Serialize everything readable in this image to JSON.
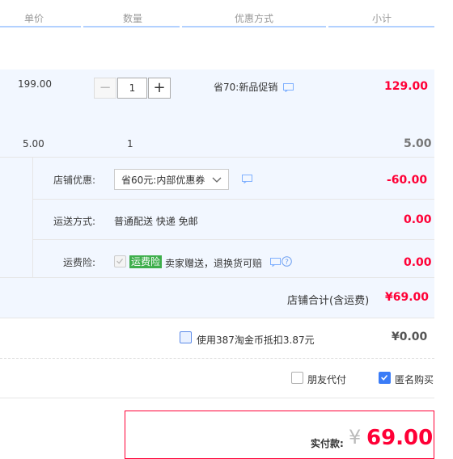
{
  "header": {
    "col_price": "单价",
    "col_qty": "数量",
    "col_discount": "优惠方式",
    "col_subtotal": "小计"
  },
  "item1": {
    "unit_price": "199.00",
    "quantity": "1",
    "minus": "−",
    "plus": "+",
    "promotion": "省70:新品促销",
    "subtotal": "129.00"
  },
  "item2": {
    "unit_price": "5.00",
    "quantity": "1",
    "subtotal": "5.00"
  },
  "shop_discount": {
    "label": "店铺优惠:",
    "selected": "省60元:内部优惠券",
    "amount": "-60.00"
  },
  "shipping": {
    "label": "运送方式:",
    "value": "普通配送 快递 免邮",
    "amount": "0.00"
  },
  "insurance": {
    "label": "运费险:",
    "badge": "运费险",
    "text": "卖家赠送，退换货可赔",
    "amount": "0.00"
  },
  "shop_total": {
    "label": "店铺合计(含运费)",
    "amount": "¥69.00"
  },
  "coins": {
    "text": "使用387淘金币抵扣3.87元",
    "amount": "¥0.00"
  },
  "options": {
    "friend_pay": "朋友代付",
    "anonymous": "匿名购买"
  },
  "payment": {
    "label": "实付款:",
    "currency": "¥",
    "amount": "69.00"
  },
  "colors": {
    "accent_red": "#ff0036",
    "header_blue": "#b2d1ff",
    "row_blue": "#f2f7ff",
    "badge_green": "#3dae4b"
  }
}
